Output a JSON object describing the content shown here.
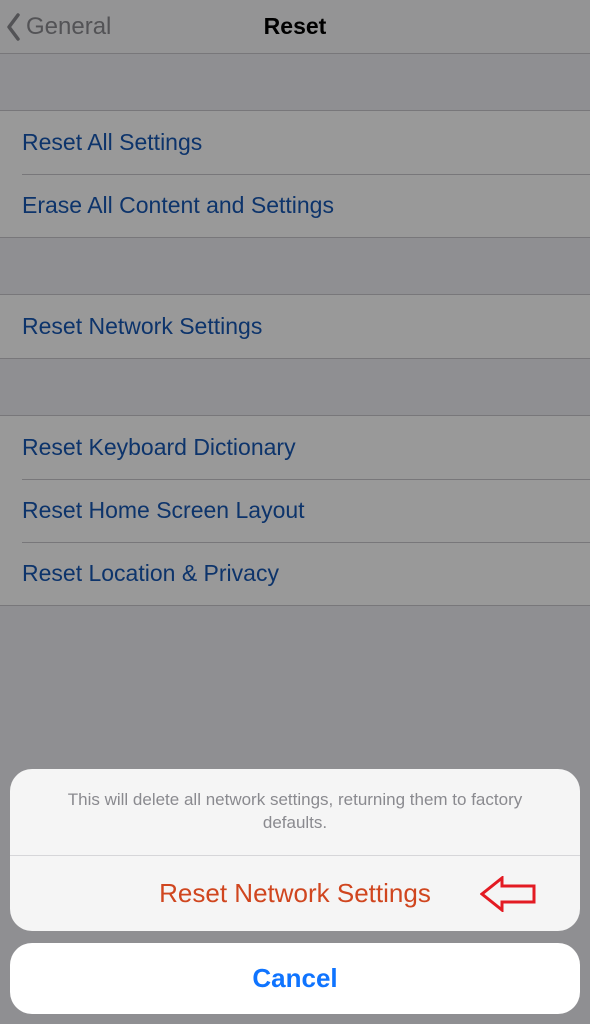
{
  "navbar": {
    "back_label": "General",
    "title": "Reset"
  },
  "groups": [
    {
      "items": [
        {
          "label": "Reset All Settings"
        },
        {
          "label": "Erase All Content and Settings"
        }
      ]
    },
    {
      "items": [
        {
          "label": "Reset Network Settings"
        }
      ]
    },
    {
      "items": [
        {
          "label": "Reset Keyboard Dictionary"
        },
        {
          "label": "Reset Home Screen Layout"
        },
        {
          "label": "Reset Location & Privacy"
        }
      ]
    }
  ],
  "action_sheet": {
    "message": "This will delete all network settings, returning them to factory defaults.",
    "destructive_label": "Reset Network Settings",
    "cancel_label": "Cancel"
  },
  "colors": {
    "link": "#1757b3",
    "destructive": "#d0461f",
    "cancel": "#0f74ff",
    "annotation": "#e31b23"
  }
}
